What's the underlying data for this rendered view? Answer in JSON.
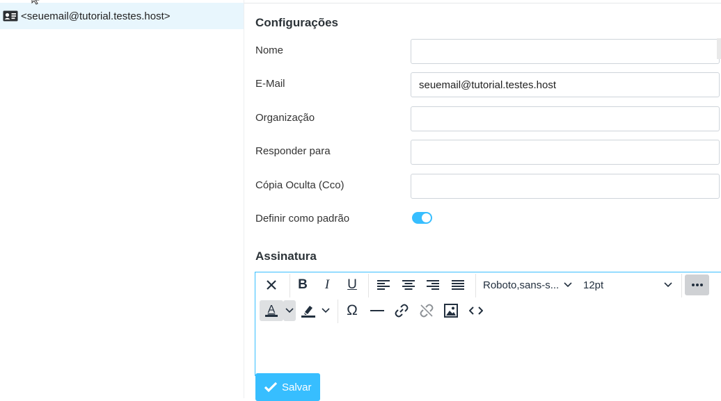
{
  "identities": {
    "items": [
      {
        "label": "<seuemail@tutorial.testes.host>"
      }
    ]
  },
  "settings": {
    "title": "Configurações",
    "name_label": "Nome",
    "name_value": "",
    "email_label": "E-Mail",
    "email_value": "seuemail@tutorial.testes.host",
    "organization_label": "Organização",
    "organization_value": "",
    "reply_to_label": "Responder para",
    "reply_to_value": "",
    "bcc_label": "Cópia Oculta (Cco)",
    "bcc_value": "",
    "default_label": "Definir como padrão",
    "default_enabled": true
  },
  "signature": {
    "title": "Assinatura",
    "font_family": "Roboto,sans-s...",
    "font_size": "12pt"
  },
  "actions": {
    "save_label": "Salvar"
  },
  "colors": {
    "accent": "#37beff",
    "selected_row": "#e8f6fd"
  },
  "icons": [
    "identity-card-icon",
    "clear-format-icon",
    "bold-icon",
    "italic-icon",
    "underline-icon",
    "align-left-icon",
    "align-center-icon",
    "align-right-icon",
    "justify-icon",
    "more-icon",
    "text-color-icon",
    "highlight-icon",
    "omega-icon",
    "horizontal-rule-icon",
    "link-icon",
    "unlink-icon",
    "image-icon",
    "source-code-icon",
    "check-icon"
  ]
}
